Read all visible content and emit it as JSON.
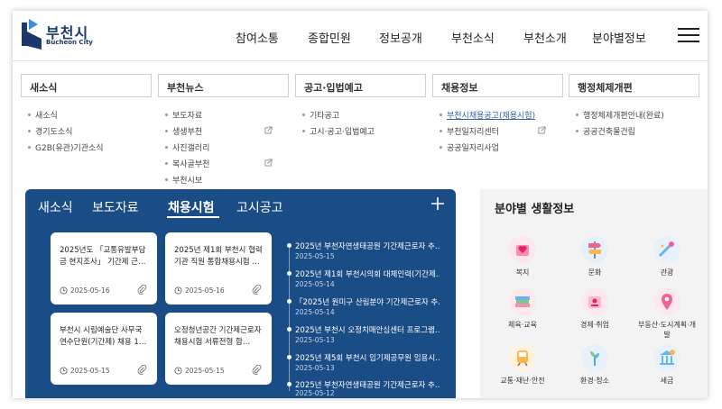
{
  "header": {
    "logo_name": "부천시",
    "logo_sub": "Bucheon City",
    "nav": [
      "참여소통",
      "종합민원",
      "정보공개",
      "부천소식",
      "부천소개",
      "분야별정보"
    ]
  },
  "megamenu": {
    "columns": [
      {
        "title": "새소식",
        "items": [
          "새소식",
          "경기도소식",
          "G2B(유관)기관소식"
        ]
      },
      {
        "title": "부천뉴스",
        "items": [
          "보도자료",
          "생생부천",
          "사진갤러리",
          "복사골부천",
          "부천시보"
        ]
      },
      {
        "title": "공고·입법예고",
        "items": [
          "기타공고",
          "고시·공고·입법예고"
        ]
      },
      {
        "title": "채용정보",
        "items": [
          "부천시채용공고(채용시험)",
          "부천일자리센터",
          "공공일자리사업"
        ]
      },
      {
        "title": "행정체제개편",
        "items": [
          "행정체제개편안내(완료)",
          "공공건축물건립"
        ]
      }
    ]
  },
  "news": {
    "tabs": [
      "새소식",
      "보도자료",
      "채용시험",
      "고시공고"
    ],
    "active_tab": "채용시험",
    "cards": [
      {
        "title": "2025년도 「교통유발부담금 현지조사」 기간제 근…",
        "date": "2025-05-16"
      },
      {
        "title": "2025년 제1회 부천시 협력기관 직원 통합채용시험 …",
        "date": "2025-05-16"
      },
      {
        "title": "부천시 시립예술단 사무국 연수단원(기간제) 채용 1…",
        "date": "2025-05-15"
      },
      {
        "title": "오정청년공간 기간제근로자 채용시험 서류전형 합…",
        "date": "2025-05-15"
      }
    ],
    "timeline": [
      {
        "title": "2025년 부천자연생태공원 기간제근로자 추…",
        "date": "2025-05-15"
      },
      {
        "title": "2025년 제1회 부천시의회 대체인력(기간제…",
        "date": "2025-05-14"
      },
      {
        "title": "「2025년 원미구 산림분야 기간제근로자 추…",
        "date": "2025-05-14"
      },
      {
        "title": "2025년 부천시 오정치매안심센터 프로그램…",
        "date": "2025-05-13"
      },
      {
        "title": "2025년 제5회 부천시 임기제공무원 임용시…",
        "date": "2025-05-13"
      },
      {
        "title": "2025년 부천자연생태공원 기간제근로자 추…",
        "date": "2025-05-12"
      }
    ]
  },
  "field": {
    "title": "분야별 생활정보",
    "items": [
      {
        "label": "복지",
        "icon": "heart-box-icon"
      },
      {
        "label": "문화",
        "icon": "signpost-icon"
      },
      {
        "label": "관광",
        "icon": "paint-brush-icon"
      },
      {
        "label": "체육·교육",
        "icon": "books-icon"
      },
      {
        "label": "경제·취업",
        "icon": "id-card-icon"
      },
      {
        "label": "부동산·도시계획·개발",
        "icon": "map-pin-icon"
      },
      {
        "label": "교통·재난·안전",
        "icon": "train-icon"
      },
      {
        "label": "환경·청소",
        "icon": "plant-icon"
      },
      {
        "label": "세금",
        "icon": "tax-building-icon"
      }
    ]
  },
  "colors": {
    "brand_blue": "#1a4c86",
    "logo_navy": "#1b3a6b",
    "panel_gray": "#f3f3f3"
  }
}
